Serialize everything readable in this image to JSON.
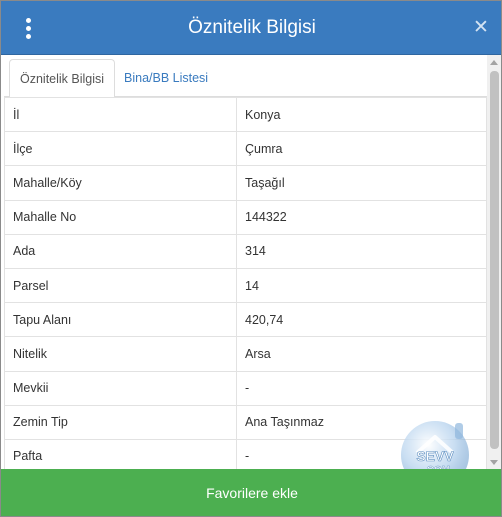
{
  "header": {
    "title": "Öznitelik Bilgisi",
    "menu_icon": "kebab-menu-icon",
    "close_symbol": "✕"
  },
  "tabs": [
    {
      "label": "Öznitelik Bilgisi",
      "active": true
    },
    {
      "label": "Bina/BB Listesi",
      "active": false
    }
  ],
  "rows": [
    {
      "key": "İl",
      "value": "Konya"
    },
    {
      "key": "İlçe",
      "value": "Çumra"
    },
    {
      "key": "Mahalle/Köy",
      "value": "Taşağıl"
    },
    {
      "key": "Mahalle No",
      "value": "144322"
    },
    {
      "key": "Ada",
      "value": "314"
    },
    {
      "key": "Parsel",
      "value": "14"
    },
    {
      "key": "Tapu Alanı",
      "value": "420,74"
    },
    {
      "key": "Nitelik",
      "value": "Arsa"
    },
    {
      "key": "Mevkii",
      "value": "-"
    },
    {
      "key": "Zemin Tip",
      "value": "Ana Taşınmaz"
    },
    {
      "key": "Pafta",
      "value": "-"
    }
  ],
  "footer": {
    "button_label": "Favorilere ekle"
  },
  "watermark": {
    "top": "SEVV",
    "bottom": ".COM"
  },
  "colors": {
    "header": "#3a7bbf",
    "footer": "#4caf50",
    "link": "#3a7bbf"
  }
}
